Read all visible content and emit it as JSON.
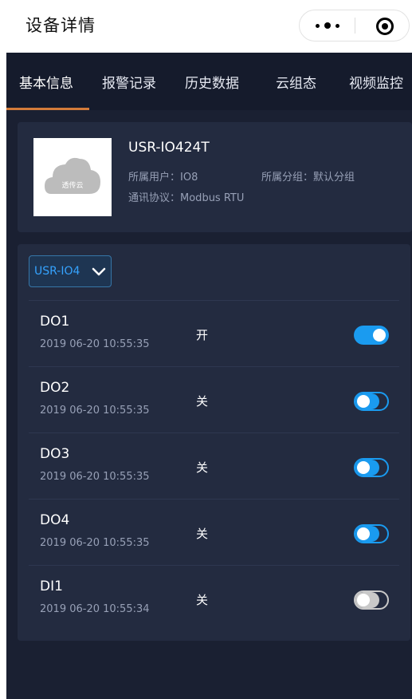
{
  "header": {
    "title": "设备详情"
  },
  "tabs": [
    {
      "label": "基本信息",
      "active": true
    },
    {
      "label": "报警记录",
      "active": false
    },
    {
      "label": "历史数据",
      "active": false
    },
    {
      "label": "云组态",
      "active": false
    },
    {
      "label": "视频监控",
      "active": false
    }
  ],
  "device": {
    "name": "USR-IO424T",
    "thumb_text": "透传云",
    "user_label": "所属用户：",
    "user_value": "IO8",
    "group_label": "所属分组：",
    "group_value": "默认分组",
    "protocol_label": "通讯协议：",
    "protocol_value": "Modbus RTU"
  },
  "selector": {
    "value": "USR-IO4"
  },
  "rows": [
    {
      "name": "DO1",
      "time": "2019 06-20 10:55:35",
      "state": "开",
      "toggle": "on"
    },
    {
      "name": "DO2",
      "time": "2019 06-20 10:55:35",
      "state": "关",
      "toggle": "off"
    },
    {
      "name": "DO3",
      "time": "2019 06-20 10:55:35",
      "state": "关",
      "toggle": "off"
    },
    {
      "name": "DO4",
      "time": "2019 06-20 10:55:35",
      "state": "关",
      "toggle": "off"
    },
    {
      "name": "DI1",
      "time": "2019 06-20 10:55:34",
      "state": "关",
      "toggle": "disabled"
    }
  ],
  "colors": {
    "accent": "#1a9bf0",
    "tab_underline": "#d47b3a",
    "background": "#1a2032",
    "card": "#232b40"
  }
}
